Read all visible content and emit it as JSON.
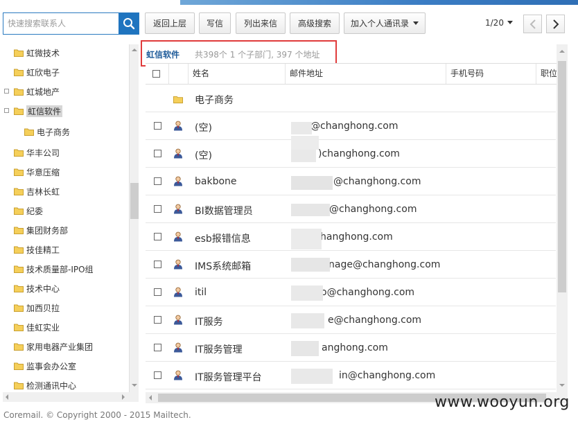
{
  "search": {
    "placeholder": "快速搜索联系人"
  },
  "toolbar": {
    "back": "返回上层",
    "compose": "写信",
    "list_mail": "列出来信",
    "advanced_search": "高级搜索",
    "add_personal": "加入个人通讯录"
  },
  "pager": {
    "page": "1/20"
  },
  "tree": {
    "items": [
      {
        "label": "虹微技术"
      },
      {
        "label": "虹欣电子"
      },
      {
        "label": "虹城地产"
      },
      {
        "label": "虹信软件"
      },
      {
        "label": "电子商务"
      },
      {
        "label": "华丰公司"
      },
      {
        "label": "华意压缩"
      },
      {
        "label": "吉林长虹"
      },
      {
        "label": "纪委"
      },
      {
        "label": "集团财务部"
      },
      {
        "label": "技佳精工"
      },
      {
        "label": "技术质量部-IPO组"
      },
      {
        "label": "技术中心"
      },
      {
        "label": "加西贝拉"
      },
      {
        "label": "佳虹实业"
      },
      {
        "label": "家用电器产业集团"
      },
      {
        "label": "监事会办公室"
      },
      {
        "label": "检测通讯中心"
      }
    ]
  },
  "dept": {
    "title": "虹信软件",
    "stats": "共398个 1 个子部门, 397 个地址"
  },
  "table": {
    "columns": [
      "姓名",
      "邮件地址",
      "手机号码",
      "职位"
    ],
    "subfolder": "电子商务",
    "rows": [
      {
        "name": "(空)",
        "email": "@changhong.com"
      },
      {
        "name": "(空)",
        "email": ")changhong.com"
      },
      {
        "name": "bakbone",
        "email": "@changhong.com"
      },
      {
        "name": "BI数据管理员",
        "email": "@changhong.com"
      },
      {
        "name": "esb报错信息",
        "email": "hanghong.com"
      },
      {
        "name": "IMS系统邮箱",
        "email": "nage@changhong.com"
      },
      {
        "name": "itil",
        "email": "o@changhong.com"
      },
      {
        "name": "IT服务",
        "email": "e@changhong.com"
      },
      {
        "name": "IT服务管理",
        "email": "anghong.com"
      },
      {
        "name": "IT服务管理平台",
        "email": "in@changhong.com"
      }
    ]
  },
  "footer": {
    "copyright": "Coremail. © Copyright 2000 - 2015 Mailtech."
  },
  "watermark": "www.wooyun.org",
  "colors": {
    "accent": "#1f74bf",
    "highlight_box": "#e03b3b",
    "dept_title": "#1f5c9a",
    "folder": "#f0c040"
  },
  "icons": {
    "search": "search-icon",
    "folder": "folder-icon",
    "user": "user-icon",
    "prev": "chevron-left-icon",
    "next": "chevron-right-icon"
  }
}
